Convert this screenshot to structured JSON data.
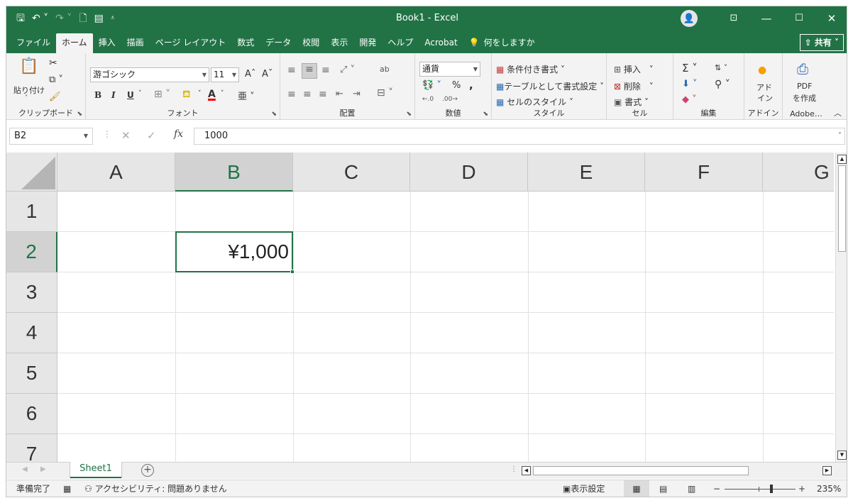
{
  "window": {
    "title": "Book1  -  Excel",
    "quick_access": [
      "save-icon",
      "undo-icon",
      "redo-icon",
      "new-file-icon",
      "form-icon",
      "customize-qat-icon"
    ],
    "controls": [
      "ribbon-display-icon",
      "minimize-icon",
      "maximize-icon",
      "close-icon"
    ]
  },
  "tabs": [
    "ファイル",
    "ホーム",
    "挿入",
    "描画",
    "ページ レイアウト",
    "数式",
    "データ",
    "校閲",
    "表示",
    "開発",
    "ヘルプ",
    "Acrobat"
  ],
  "active_tab": "ホーム",
  "tell_me": "何をしますか",
  "share_label": "共有",
  "ribbon": {
    "clipboard": {
      "paste": "貼り付け",
      "label": "クリップボード"
    },
    "font": {
      "name": "游ゴシック",
      "size": "11",
      "bold": "B",
      "italic": "I",
      "underline": "U",
      "font_color_letter": "A",
      "grow": "Aˆ",
      "shrink": "Aˇ",
      "label": "フォント"
    },
    "alignment": {
      "label": "配置",
      "wrap": "ab"
    },
    "number": {
      "format": "通貨",
      "percent": "%",
      "comma": ",",
      "label": "数値"
    },
    "styles": {
      "conditional": "条件付き書式",
      "table": "テーブルとして書式設定",
      "cell": "セルのスタイル",
      "label": "スタイル"
    },
    "cells": {
      "insert": "挿入",
      "delete": "削除",
      "format": "書式",
      "label": "セル"
    },
    "editing": {
      "label": "編集"
    },
    "addins": {
      "line1": "アド",
      "line2": "イン",
      "label": "アドイン"
    },
    "adobe": {
      "line1": "PDF",
      "line2": "を作成",
      "label": "Adobe…"
    }
  },
  "formula_bar": {
    "name_box": "B2",
    "cancel": "✕",
    "enter": "✓",
    "fx": "fx",
    "value": "1000"
  },
  "grid": {
    "columns": [
      "A",
      "B",
      "C",
      "D",
      "E",
      "F",
      "G"
    ],
    "rows": [
      "1",
      "2",
      "3",
      "4",
      "5",
      "6",
      "7"
    ],
    "selected_column": "B",
    "selected_row": "2",
    "cell_b2": "¥1,000"
  },
  "sheet": {
    "tab": "Sheet1"
  },
  "status": {
    "ready": "準備完了",
    "accessibility": "アクセシビリティ: 問題ありません",
    "display_settings": "表示設定",
    "zoom": "235%",
    "zoom_minus": "−",
    "zoom_plus": "+"
  }
}
